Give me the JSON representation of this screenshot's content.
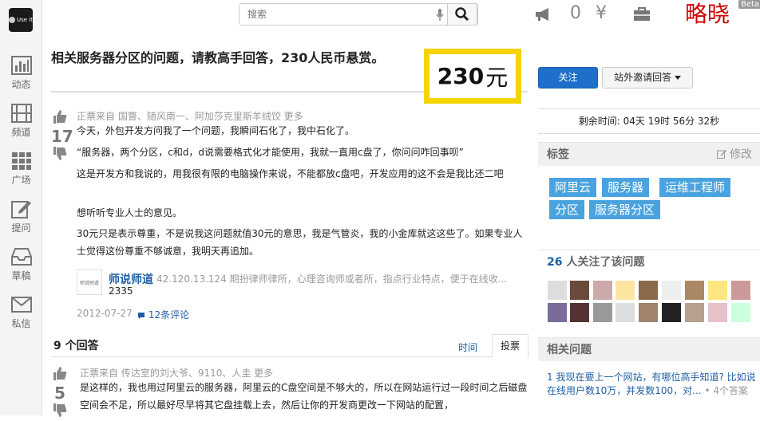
{
  "logo": {
    "text": "Use it"
  },
  "nav": [
    {
      "label": "动态",
      "icon": "bar-chart-icon"
    },
    {
      "label": "频道",
      "icon": "film-icon"
    },
    {
      "label": "广场",
      "icon": "grid-icon"
    },
    {
      "label": "提问",
      "icon": "edit-icon"
    },
    {
      "label": "草稿",
      "icon": "inbox-icon"
    },
    {
      "label": "私信",
      "icon": "mail-icon"
    }
  ],
  "topbar": {
    "search_placeholder": "搜索",
    "notification_count": "0",
    "currency_symbol": "¥",
    "brand": "略晓",
    "beta": "Beta"
  },
  "question": {
    "title": "相关服务器分区的问题，请教高手回答，230人民币悬赏。",
    "bounty_amount": "230",
    "bounty_unit": "元",
    "votes": "17",
    "voters": "正票来自 国瞥、随风南一、阿加莎克里斯羊绒饺 更多",
    "paragraphs": [
      "今天，外包开发方问我了一个问题，我瞬间石化了，我中石化了。",
      "“服务器，两个分区，c和d，d说需要格式化才能使用，我就一直用c盘了，你问问咋回事呗”",
      "这是开发方和我说的，用我很有限的电脑操作来说，不能都放c盘吧，开发应用的这不会是我比还二吧",
      "想听听专业人士的意见。",
      "30元只是表示尊重，不是说我这问题就值30元的意思，我是气管炎，我的小金库就这这些了。如果专业人士觉得这份尊重不够诚意，我明天再追加。"
    ],
    "author": {
      "avatar_text": "师说师道",
      "name": "师说师道",
      "desc": "42.120.13.124 期扮律师律所，心理咨询师或者所，指点行业特点，便于在线收...",
      "score": "2335"
    },
    "date": "2012-07-27",
    "comments": "12条评论"
  },
  "answers": {
    "count_label": "9 个回答",
    "sort_time": "时间",
    "sort_vote": "投票",
    "first": {
      "votes": "5",
      "voters": "正票来自 传达室的刘大爷、9110、人圭 更多",
      "text": "是这样的，我也用过阿里云的服务器，阿里云的C盘空间是不够大的，所以在网站运行过一段时间之后磁盘空间会不足，所以最好尽早将其它盘挂载上去，然后让你的开发商更改一下网站的配置，"
    }
  },
  "sidebar": {
    "follow_button": "关注",
    "invite_button": "站外邀请回答",
    "remaining": "剩余时间:  04天 19时 56分 32秒",
    "tags_heading": "标签",
    "tags_edit": "修改",
    "tags": [
      "阿里云",
      "服务器",
      "运维工程师",
      "分区",
      "服务器分区"
    ],
    "followers_count": "26",
    "followers_label": "人关注了该问题",
    "related_heading": "相关问题",
    "related_item": "1 我现在要上一个网站，有哪位高手知道? 比如说在线用户数10万，并发数100，对...",
    "related_count": "• 4个答案"
  },
  "colors": {
    "accent": "#1f6ec9",
    "tag": "#4aa3df",
    "bounty_border": "#f5d400",
    "brand": "#cc0000",
    "link": "#1f5fa6"
  }
}
